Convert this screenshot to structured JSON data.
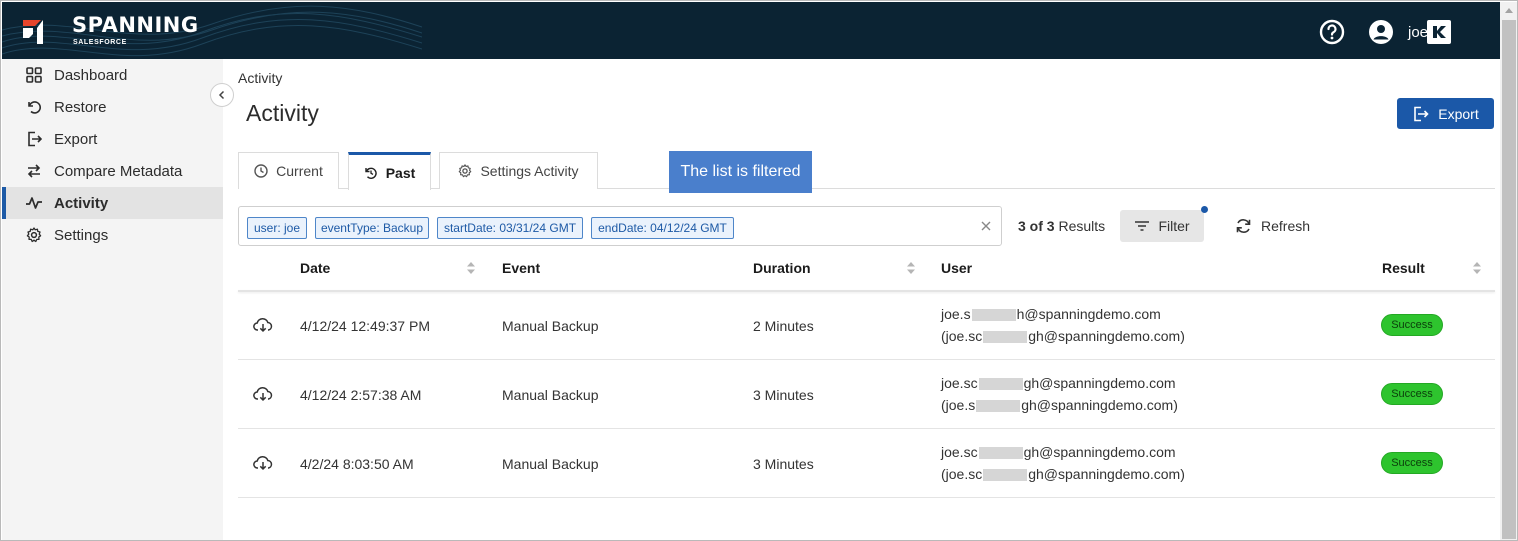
{
  "header": {
    "brand": "SPANNING",
    "brand_sub": "SALESFORCE",
    "username": "joe",
    "colors": {
      "bg": "#0b2333",
      "logo_accent": "#e8452c"
    }
  },
  "sidebar": {
    "items": [
      {
        "label": "Dashboard",
        "icon": "grid-icon"
      },
      {
        "label": "Restore",
        "icon": "restore-icon"
      },
      {
        "label": "Export",
        "icon": "export-icon"
      },
      {
        "label": "Compare Metadata",
        "icon": "compare-arrows-icon"
      },
      {
        "label": "Activity",
        "icon": "activity-pulse-icon",
        "active": true
      },
      {
        "label": "Settings",
        "icon": "gear-icon"
      }
    ]
  },
  "main": {
    "breadcrumb": "Activity",
    "title": "Activity",
    "export_label": "Export",
    "tabs": [
      {
        "label": "Current",
        "icon": "clock-icon"
      },
      {
        "label": "Past",
        "icon": "history-icon",
        "active": true
      },
      {
        "label": "Settings Activity",
        "icon": "gear-icon"
      }
    ],
    "tooltip": "The list is filtered",
    "filters": [
      "user: joe",
      "eventType: Backup",
      "startDate: 03/31/24 GMT",
      "endDate: 04/12/24 GMT"
    ],
    "results_count": "3 of 3",
    "results_label": "Results",
    "filter_label": "Filter",
    "refresh_label": "Refresh"
  },
  "table": {
    "columns": [
      "Date",
      "Event",
      "Duration",
      "User",
      "Result"
    ],
    "rows": [
      {
        "date": "4/12/24 12:49:37 PM",
        "event": "Manual Backup",
        "duration": "2 Minutes",
        "user1_pre": "joe.s",
        "user1_post": "h@spanningdemo.com",
        "user2_pre": "(joe.sc",
        "user2_post": "gh@spanningdemo.com)",
        "result": "Success"
      },
      {
        "date": "4/12/24 2:57:38 AM",
        "event": "Manual Backup",
        "duration": "3 Minutes",
        "user1_pre": "joe.sc",
        "user1_post": "gh@spanningdemo.com",
        "user2_pre": "(joe.s",
        "user2_post": "gh@spanningdemo.com)",
        "result": "Success"
      },
      {
        "date": "4/2/24 8:03:50 AM",
        "event": "Manual Backup",
        "duration": "3 Minutes",
        "user1_pre": "joe.sc",
        "user1_post": "gh@spanningdemo.com",
        "user2_pre": "(joe.sc",
        "user2_post": "gh@spanningdemo.com)",
        "result": "Success"
      }
    ]
  }
}
